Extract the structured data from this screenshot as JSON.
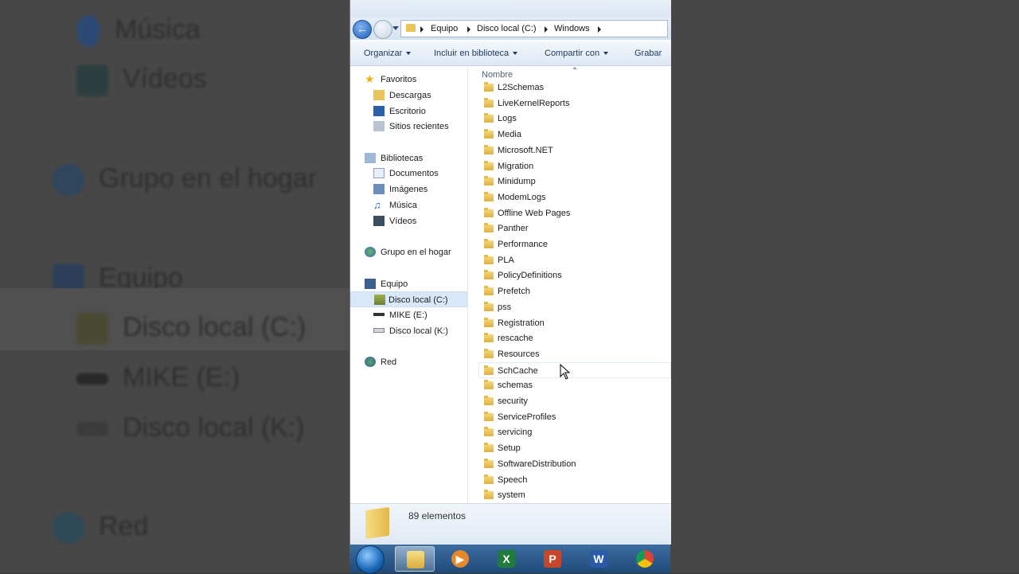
{
  "background": {
    "items": [
      "Música",
      "Vídeos",
      "Grupo en el hogar",
      "Equipo",
      "Disco local (C:)",
      "MIKE (E:)",
      "Disco local (K:)",
      "Red"
    ]
  },
  "address": {
    "crumbs": [
      "Equipo",
      "Disco local (C:)",
      "Windows"
    ]
  },
  "toolbar": {
    "organize": "Organizar",
    "include": "Incluir en biblioteca",
    "share": "Compartir con",
    "burn": "Grabar"
  },
  "nav": {
    "favorites": "Favoritos",
    "downloads": "Descargas",
    "desktop": "Escritorio",
    "recent": "Sitios recientes",
    "libraries": "Bibliotecas",
    "documents": "Documentos",
    "pictures": "Imágenes",
    "music": "Música",
    "videos": "Vídeos",
    "homegroup": "Grupo en el hogar",
    "computer": "Equipo",
    "drive_c": "Disco local (C:)",
    "drive_e": "MIKE (E:)",
    "drive_k": "Disco local (K:)",
    "network": "Red"
  },
  "files": {
    "column": "Nombre",
    "items": [
      "L2Schemas",
      "LiveKernelReports",
      "Logs",
      "Media",
      "Microsoft.NET",
      "Migration",
      "Minidump",
      "ModemLogs",
      "Offline Web Pages",
      "Panther",
      "Performance",
      "PLA",
      "PolicyDefinitions",
      "Prefetch",
      "pss",
      "Registration",
      "rescache",
      "Resources",
      "SchCache",
      "schemas",
      "security",
      "ServiceProfiles",
      "servicing",
      "Setup",
      "SoftwareDistribution",
      "Speech",
      "system"
    ]
  },
  "status": {
    "count": "89 elementos"
  },
  "colors": {
    "folder": "#e9c458",
    "accent": "#1d5eb8",
    "selection": "#d9e8f9"
  }
}
